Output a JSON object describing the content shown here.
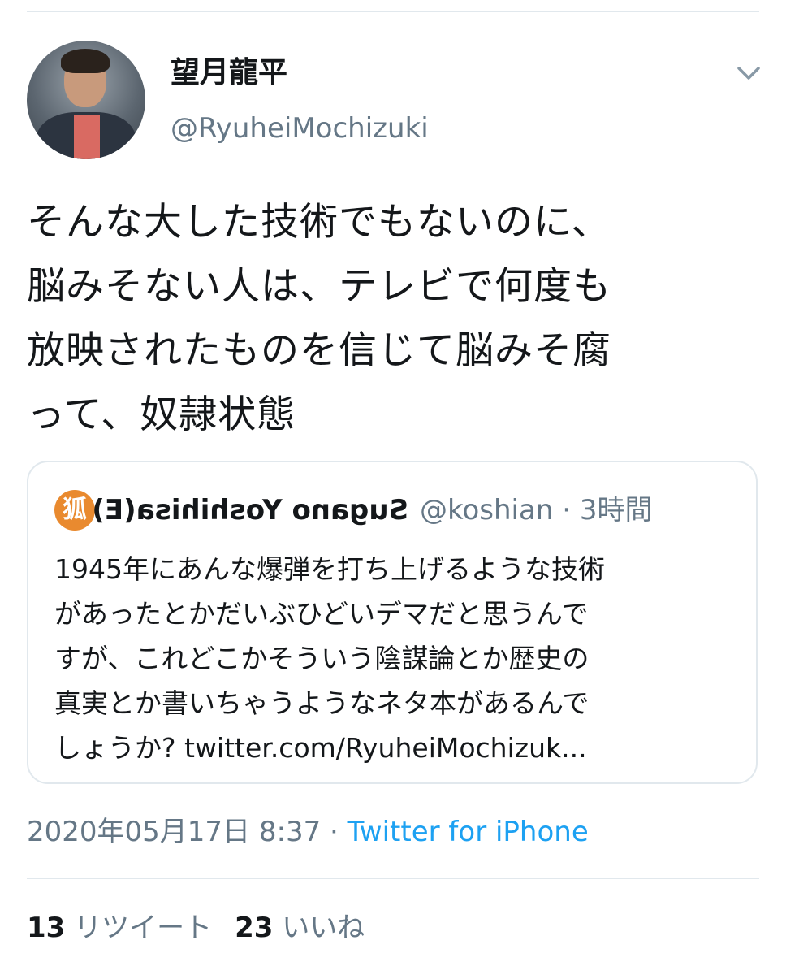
{
  "author": {
    "display_name": "望月龍平",
    "handle": "@RyuheiMochizuki"
  },
  "tweet": {
    "lines": [
      "そんな大した技術でもないのに、",
      "脳みそない人は、テレビで何度も",
      "放映されたものを信じて脳みそ腐",
      "って、奴隷状態"
    ]
  },
  "quoted_tweet": {
    "avatar_glyph": "狐",
    "display_name": "Sugano Yoshihisa(E)",
    "handle": "@koshian",
    "separator": "·",
    "time": "3時間",
    "lines": [
      "1945年にあんな爆弾を打ち上げるような技術",
      "があったとかだいぶひどいデマだと思うんで",
      "すが、これどこかそういう陰謀論とか歴史の",
      "真実とか書いちゃうようなネタ本があるんで",
      "しょうか? twitter.com/RyuheiMochizuk..."
    ]
  },
  "meta": {
    "timestamp": "2020年05月17日 8:37",
    "separator": "·",
    "source": "Twitter for iPhone"
  },
  "stats": {
    "retweets_count": "13",
    "retweets_label": "リツイート",
    "likes_count": "23",
    "likes_label": "いいね"
  },
  "icons": {
    "caret": "chevron-down-icon",
    "avatar_color": "#e98a2f"
  },
  "colors": {
    "text": "#14171a",
    "secondary": "#657786",
    "link": "#1da1f2",
    "border": "#e1e8ed"
  }
}
